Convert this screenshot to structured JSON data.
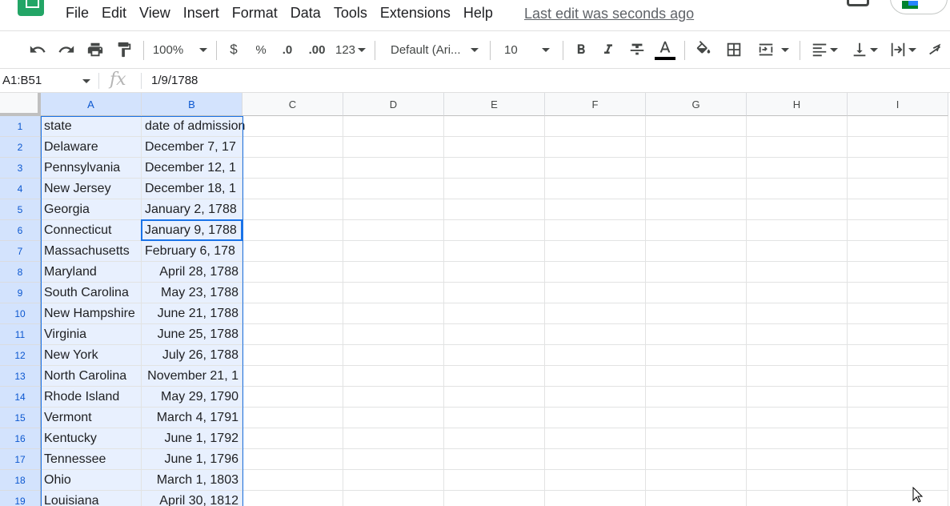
{
  "menu": {
    "items": [
      "File",
      "Edit",
      "View",
      "Insert",
      "Format",
      "Data",
      "Tools",
      "Extensions",
      "Help"
    ],
    "last_edit": "Last edit was seconds ago"
  },
  "toolbar": {
    "zoom": "100%",
    "currency": "$",
    "percent": "%",
    "decrease_decimal": ".0",
    "increase_decimal": ".00",
    "more_formats": "123",
    "font": "Default (Ari...",
    "font_size": "10",
    "text_color_bar": "#000000"
  },
  "formula_bar": {
    "name_box": "A1:B51",
    "fx": "fx",
    "value": "1/9/1788"
  },
  "columns": [
    "A",
    "B",
    "C",
    "D",
    "E",
    "F",
    "G",
    "H",
    "I"
  ],
  "rows": [
    {
      "n": "1",
      "a": "state",
      "b": "date of admission"
    },
    {
      "n": "2",
      "a": "Delaware",
      "b": "December 7, 17"
    },
    {
      "n": "3",
      "a": "Pennsylvania",
      "b": "December 12, 1"
    },
    {
      "n": "4",
      "a": "New Jersey",
      "b": "December 18, 1"
    },
    {
      "n": "5",
      "a": "Georgia",
      "b": "January 2, 1788"
    },
    {
      "n": "6",
      "a": "Connecticut",
      "b": "January 9, 1788"
    },
    {
      "n": "7",
      "a": "Massachusetts",
      "b": "February 6, 178"
    },
    {
      "n": "8",
      "a": "Maryland",
      "b": "April 28, 1788"
    },
    {
      "n": "9",
      "a": "South Carolina",
      "b": "May 23, 1788"
    },
    {
      "n": "10",
      "a": "New Hampshire",
      "b": "June 21, 1788"
    },
    {
      "n": "11",
      "a": "Virginia",
      "b": "June 25, 1788"
    },
    {
      "n": "12",
      "a": "New York",
      "b": "July 26, 1788"
    },
    {
      "n": "13",
      "a": "North Carolina",
      "b": "November 21, 1"
    },
    {
      "n": "14",
      "a": "Rhode Island",
      "b": "May 29, 1790"
    },
    {
      "n": "15",
      "a": "Vermont",
      "b": "March 4, 1791"
    },
    {
      "n": "16",
      "a": "Kentucky",
      "b": "June 1, 1792"
    },
    {
      "n": "17",
      "a": "Tennessee",
      "b": "June 1, 1796"
    },
    {
      "n": "18",
      "a": "Ohio",
      "b": "March 1, 1803"
    },
    {
      "n": "19",
      "a": "Louisiana",
      "b": "April 30, 1812"
    }
  ],
  "colors": {
    "selection_fill": "#e8f0fe",
    "selection_border": "#1a73e8",
    "header_selected": "#d3e3fd",
    "logo": "#23a566"
  }
}
